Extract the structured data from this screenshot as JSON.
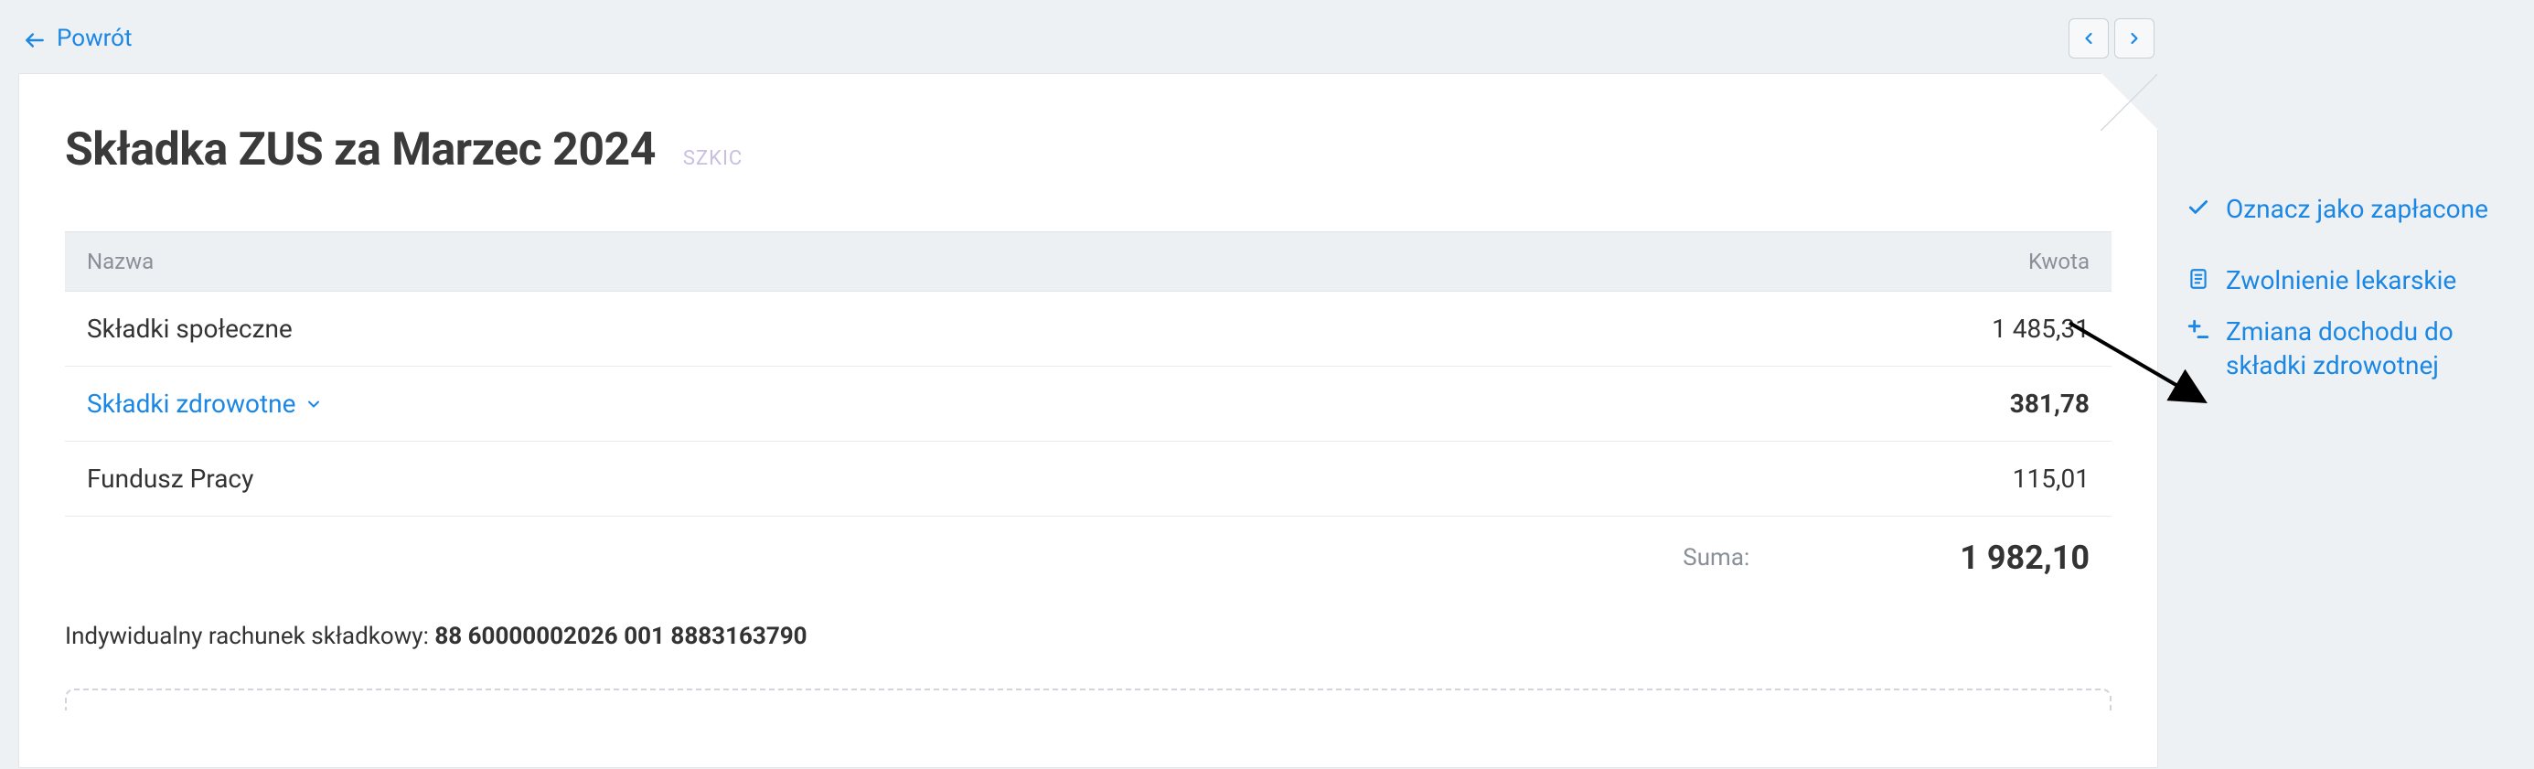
{
  "topbar": {
    "back_label": "Powrót"
  },
  "header": {
    "title": "Składka ZUS za Marzec 2024",
    "draft_label": "SZKIC"
  },
  "table": {
    "columns": {
      "name": "Nazwa",
      "amount": "Kwota"
    },
    "rows": [
      {
        "name": "Składki społeczne",
        "amount": "1 485,31",
        "link": false,
        "bold": false,
        "expandable": false
      },
      {
        "name": "Składki zdrowotne",
        "amount": "381,78",
        "link": true,
        "bold": true,
        "expandable": true
      },
      {
        "name": "Fundusz Pracy",
        "amount": "115,01",
        "link": false,
        "bold": false,
        "expandable": false
      }
    ],
    "sum_label": "Suma:",
    "sum_value": "1 982,10"
  },
  "account": {
    "label": "Indywidualny rachunek składkowy:",
    "number": "88 60000002026 001 8883163790"
  },
  "actions": [
    {
      "id": "mark-paid",
      "label": "Oznacz jako zapłacone",
      "icon": "check-icon"
    },
    {
      "id": "sick-leave",
      "label": "Zwolnienie lekarskie",
      "icon": "document-icon"
    },
    {
      "id": "change-income",
      "label": "Zmiana dochodu do składki zdrowotnej",
      "icon": "plus-minus-icon"
    }
  ]
}
